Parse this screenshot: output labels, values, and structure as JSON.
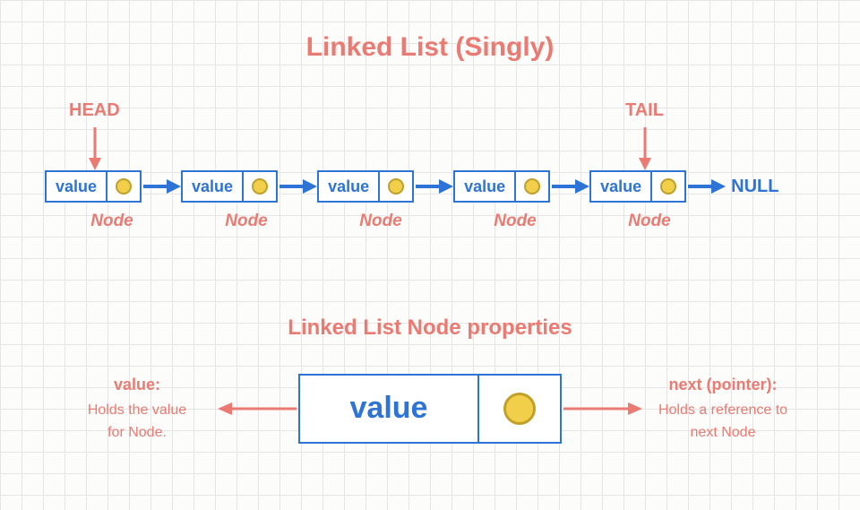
{
  "title_main": "Linked List (Singly)",
  "head_label": "HEAD",
  "tail_label": "TAIL",
  "null_label": "NULL",
  "node_value_text": "value",
  "node_caption": "Node",
  "node_count": 5,
  "title_sub": "Linked List Node properties",
  "big_value_text": "value",
  "left_desc": {
    "header": "value:",
    "line1": "Holds the value",
    "line2": "for Node."
  },
  "right_desc": {
    "header": "next (pointer):",
    "line1": "Holds a reference to",
    "line2": "next Node"
  },
  "colors": {
    "accent_red": "#ea7a72",
    "blue": "#2d74d6",
    "dot_fill": "#f2cf4a",
    "dot_stroke": "#c19f28"
  }
}
